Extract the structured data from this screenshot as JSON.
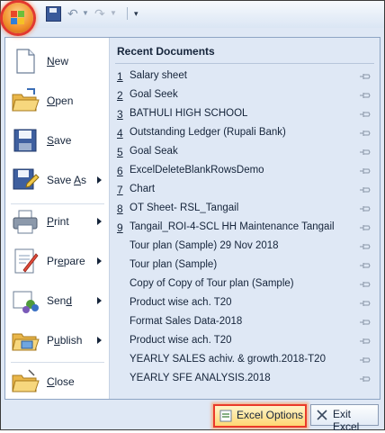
{
  "app": {
    "name": "Excel Office Menu"
  },
  "toolbar": {
    "items": [
      {
        "name": "save",
        "icon": "floppy-icon"
      },
      {
        "name": "undo",
        "icon": "undo-icon"
      },
      {
        "name": "redo",
        "icon": "redo-icon"
      },
      {
        "name": "customize",
        "icon": "chevron-down-icon"
      }
    ]
  },
  "menu": {
    "items": [
      {
        "label": "New",
        "underline": "N",
        "rest": "ew",
        "has_submenu": false,
        "icon": "new-document-icon"
      },
      {
        "label": "Open",
        "underline": "O",
        "rest": "pen",
        "has_submenu": false,
        "icon": "open-folder-icon"
      },
      {
        "label": "Save",
        "underline": "S",
        "rest": "ave",
        "has_submenu": false,
        "icon": "save-icon"
      },
      {
        "label": "Save As",
        "underline": "A",
        "prefix": "Save ",
        "rest": "s",
        "has_submenu": true,
        "icon": "save-as-icon"
      },
      {
        "label": "Print",
        "underline": "P",
        "rest": "rint",
        "has_submenu": true,
        "icon": "printer-icon"
      },
      {
        "label": "Prepare",
        "underline": "E",
        "prefix": "Pr",
        "rest": "pare",
        "has_submenu": true,
        "icon": "prepare-icon"
      },
      {
        "label": "Send",
        "underline": "D",
        "prefix": "Sen",
        "rest": "",
        "has_submenu": true,
        "icon": "send-icon"
      },
      {
        "label": "Publish",
        "underline": "U",
        "prefix": "P",
        "rest": "blish",
        "has_submenu": true,
        "icon": "publish-icon"
      },
      {
        "label": "Close",
        "underline": "C",
        "rest": "lose",
        "has_submenu": false,
        "icon": "close-document-icon"
      }
    ]
  },
  "recent": {
    "title": "Recent Documents",
    "documents": [
      {
        "num": "1",
        "name": "Salary sheet"
      },
      {
        "num": "2",
        "name": "Goal Seek"
      },
      {
        "num": "3",
        "name": "BATHULI HIGH SCHOOL"
      },
      {
        "num": "4",
        "name": "Outstanding Ledger (Rupali Bank)"
      },
      {
        "num": "5",
        "name": "Goal Seak"
      },
      {
        "num": "6",
        "name": "ExcelDeleteBlankRowsDemo"
      },
      {
        "num": "7",
        "name": "Chart"
      },
      {
        "num": "8",
        "name": "OT Sheet- RSL_Tangail"
      },
      {
        "num": "9",
        "name": "Tangail_ROI-4-SCL HH Maintenance Tangail"
      },
      {
        "num": "",
        "name": "Tour plan (Sample) 29 Nov 2018"
      },
      {
        "num": "",
        "name": "Tour plan (Sample)"
      },
      {
        "num": "",
        "name": "Copy of Copy of Tour plan (Sample)"
      },
      {
        "num": "",
        "name": "Product wise ach. T20"
      },
      {
        "num": "",
        "name": "Format Sales Data-2018"
      },
      {
        "num": "",
        "name": "Product wise ach. T20"
      },
      {
        "num": "",
        "name": "YEARLY SALES achiv. & growth.2018-T20"
      },
      {
        "num": "",
        "name": "YEARLY SFE ANALYSIS.2018"
      }
    ]
  },
  "buttons": {
    "options_label": "Excel Options",
    "exit_label": "Exit Excel"
  },
  "colors": {
    "highlight": "#ea3a2a",
    "panel_bg": "#dfe8f5",
    "text": "#15243a"
  }
}
